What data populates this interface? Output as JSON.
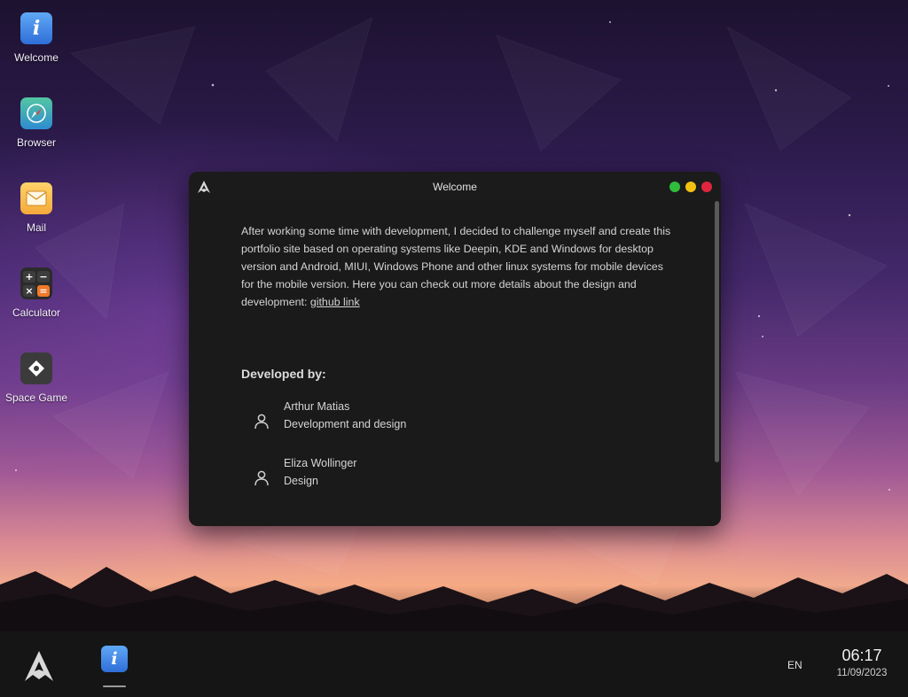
{
  "desktop": {
    "icons": [
      {
        "label": "Welcome",
        "icon": "info-icon"
      },
      {
        "label": "Browser",
        "icon": "compass-icon"
      },
      {
        "label": "Mail",
        "icon": "envelope-icon"
      },
      {
        "label": "Calculator",
        "icon": "calculator-icon"
      },
      {
        "label": "Space Game",
        "icon": "spaceship-icon"
      }
    ]
  },
  "window": {
    "title": "Welcome",
    "app_icon": "arch-logo-icon",
    "paragraph": "After working some time with development, I decided to challenge myself and create this portfolio site based on operating systems like Deepin, KDE and Windows for desktop version and Android, MIUI, Windows Phone and other linux systems for mobile devices for the mobile version. Here you can check out more details about the design and development: ",
    "link_label": "github link",
    "developed_by_heading": "Developed by:",
    "developers": [
      {
        "name": "Arthur Matias",
        "role": "Development and design",
        "icon": "user-icon"
      },
      {
        "name": "Eliza Wollinger",
        "role": "Design",
        "icon": "user-icon"
      }
    ],
    "controls": {
      "minimize_color": "#2fbd3c",
      "maximize_color": "#f2c011",
      "close_color": "#e0263e"
    }
  },
  "taskbar": {
    "start_icon": "arch-logo-icon",
    "running_apps": [
      {
        "name": "Welcome",
        "icon": "info-icon"
      }
    ],
    "language": "EN",
    "time": "06:17",
    "date": "11/09/2023"
  }
}
